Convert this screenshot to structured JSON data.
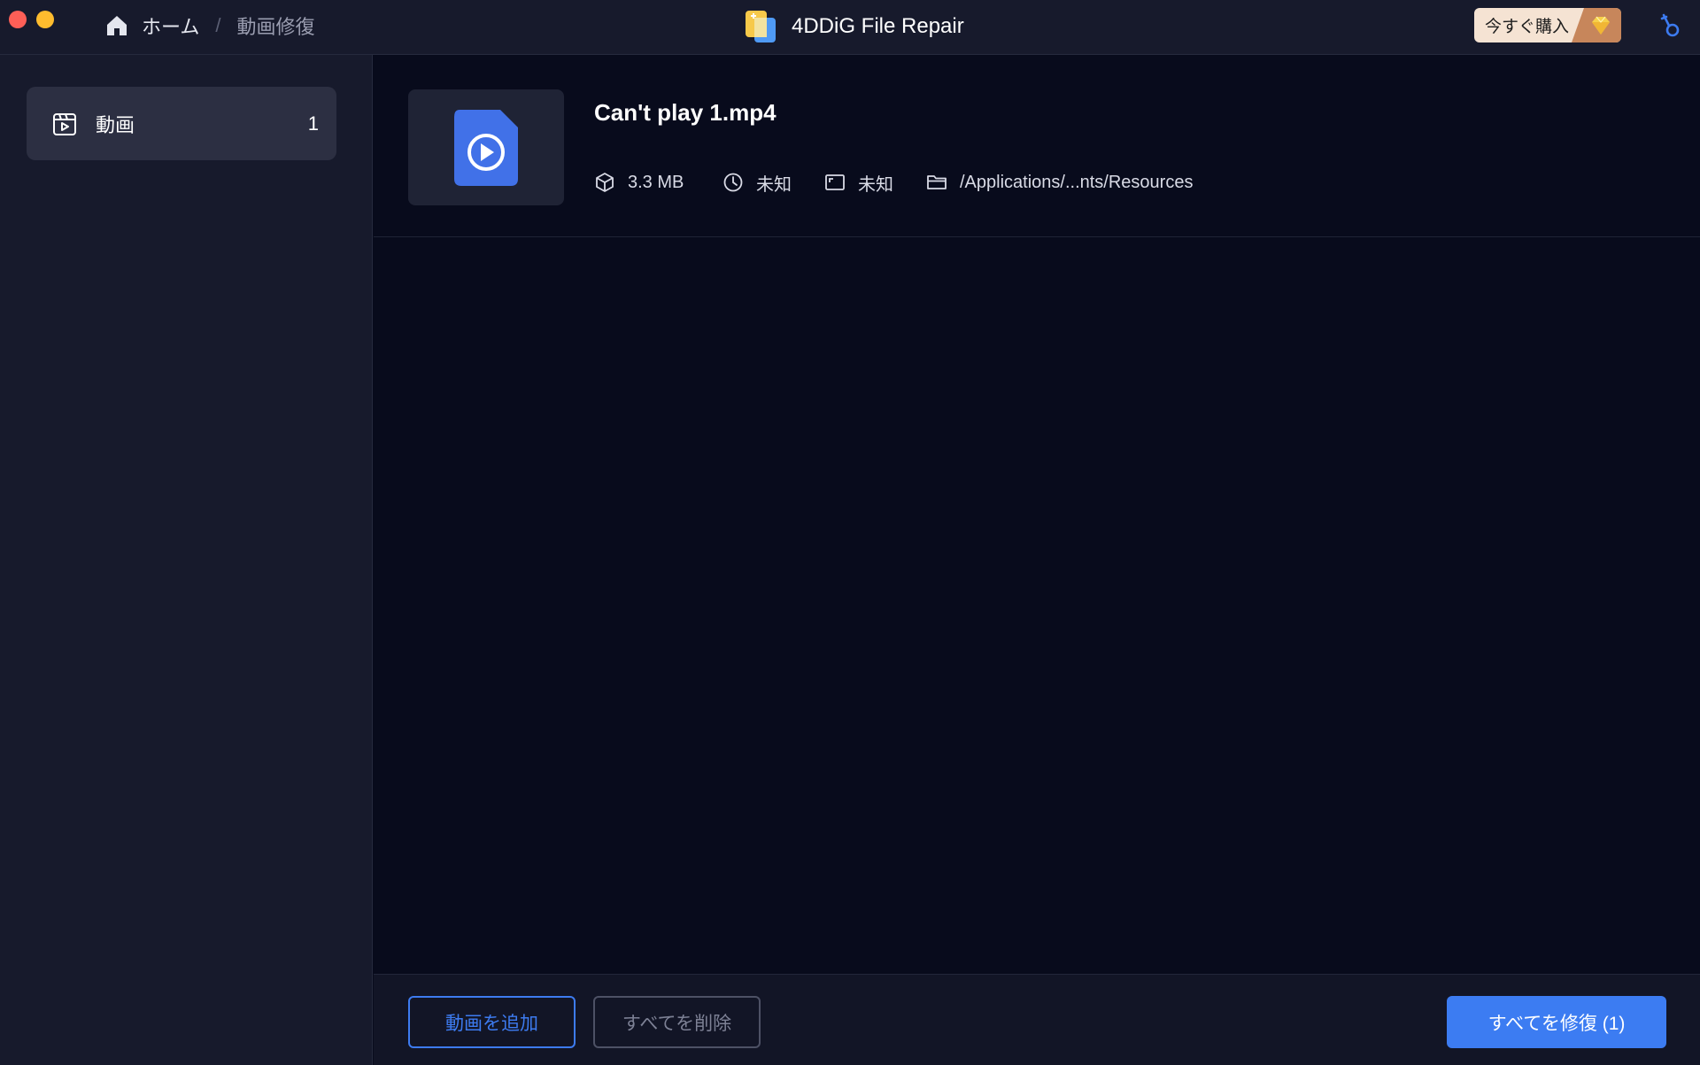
{
  "window": {
    "title": "4DDiG File Repair"
  },
  "breadcrumb": {
    "home": "ホーム",
    "separator": "/",
    "current": "動画修復"
  },
  "header": {
    "buy_label": "今すぐ購入"
  },
  "sidebar": {
    "items": [
      {
        "label": "動画",
        "count": "1",
        "icon": "video-file-icon"
      }
    ]
  },
  "files": [
    {
      "name": "Can't play 1.mp4",
      "size": "3.3 MB",
      "duration": "未知",
      "resolution": "未知",
      "path": "/Applications/...nts/Resources"
    }
  ],
  "footer": {
    "add_label": "動画を追加",
    "remove_all_label": "すべてを削除",
    "repair_all_label": "すべてを修復 (1)"
  },
  "colors": {
    "background": "#080b1c",
    "panel": "#171a2c",
    "accent": "#3c7cf2",
    "buy_button": "#f5e3d3",
    "gem": "#c7865b"
  }
}
